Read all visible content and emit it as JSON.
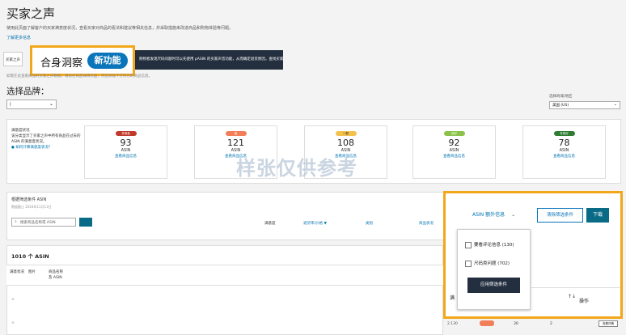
{
  "page": {
    "title": "买家之声",
    "description": "使用此页面了解客户的买家满意度状况，查看买家对商品的看法和建议等相关信息，并采取措施来改进商品和购物体验等问题。",
    "learn_more": "了解更多信息",
    "note": "如需在此查看商品的买家之声数据，请前往商品详情页面，然后添加下方所示的商品信息。"
  },
  "feature_callout": {
    "title": "合身洞察",
    "badge": "新功能"
  },
  "tabs": {
    "first": "买家之声"
  },
  "banner": {
    "text": "购物者发现尺码问题时可以先使用 pASIN 的买家声音功能，从而确定退货原因，查找买家反馈的有关尺码的问题。"
  },
  "brand": {
    "label": "选择品牌：",
    "value": "|",
    "chevron": "⌄"
  },
  "marketplace": {
    "label": "选择商城/地区",
    "value": "美国 (US)",
    "chevron": "⌄"
  },
  "overview": {
    "intro_title": "满意度状况",
    "intro_text": "该分类显示了买家之声中所有商品在过去的 ASIN 的满意度状况。",
    "intro_link": "如何计算满意度状况?",
    "stats": [
      {
        "label": "非常差",
        "value": "93",
        "unit": "ASIN",
        "link": "查看商品信息",
        "color": "#c0392b"
      },
      {
        "label": "差",
        "value": "121",
        "unit": "ASIN",
        "link": "查看商品信息",
        "color": "#f27f5a"
      },
      {
        "label": "一般",
        "value": "108",
        "unit": "ASIN",
        "link": "查看商品信息",
        "color": "#f2c14e"
      },
      {
        "label": "良好",
        "value": "92",
        "unit": "ASIN",
        "link": "查看商品信息",
        "color": "#8bc34a"
      },
      {
        "label": "非常好",
        "value": "78",
        "unit": "ASIN",
        "link": "查看商品信息",
        "color": "#2e7d32"
      }
    ]
  },
  "watermark": "样张仅供参考",
  "filters": {
    "title": "根据筛选条件 ASIN",
    "subtitle": "数据截止 2024年11月13日",
    "search_placeholder": "搜索商品名称或 ASIN",
    "columns": [
      "满意度",
      "退货率/价格 ▼",
      "类别",
      "商品状况"
    ],
    "asin_dropdown": "ASIN 额外信息",
    "clear_label": "清除筛选条件",
    "download_label": "下载"
  },
  "popup": {
    "items": [
      {
        "label": "要看评论信息 (130)"
      },
      {
        "label": "尺码类问题 (702)"
      }
    ],
    "apply_label": "应用筛选条件"
  },
  "table": {
    "count": "1010 个 ASIN",
    "headers": [
      "满意状况",
      "图片",
      "商品名称 及 ASIN"
    ],
    "right_headers": [
      "满",
      "↑↓",
      "操作"
    ],
    "rows": [
      {
        "status": "☆"
      },
      {
        "status": "☆",
        "value": "2.130",
        "returns": "30",
        "count": "2",
        "action": "查看详情"
      }
    ]
  }
}
